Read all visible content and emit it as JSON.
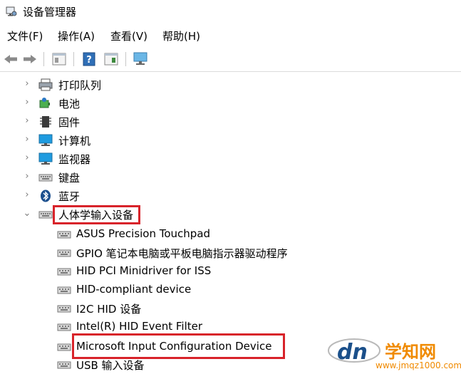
{
  "window": {
    "title": "设备管理器"
  },
  "menubar": [
    {
      "label": "文件(F)"
    },
    {
      "label": "操作(A)"
    },
    {
      "label": "查看(V)"
    },
    {
      "label": "帮助(H)"
    }
  ],
  "toolbar": {
    "buttons": [
      "back-arrow-icon",
      "forward-arrow-icon",
      "properties-icon",
      "help-icon",
      "show-hidden-icon",
      "monitor-icon"
    ]
  },
  "tree": {
    "categories": [
      {
        "label": "打印队列",
        "icon": "printer-icon",
        "expanded": false
      },
      {
        "label": "电池",
        "icon": "battery-icon",
        "expanded": false
      },
      {
        "label": "固件",
        "icon": "chip-icon",
        "expanded": false
      },
      {
        "label": "计算机",
        "icon": "computer-icon",
        "expanded": false
      },
      {
        "label": "监视器",
        "icon": "monitor-icon",
        "expanded": false
      },
      {
        "label": "键盘",
        "icon": "keyboard-icon",
        "expanded": false
      },
      {
        "label": "蓝牙",
        "icon": "bluetooth-icon",
        "expanded": false
      },
      {
        "label": "人体学输入设备",
        "icon": "hid-icon",
        "expanded": true,
        "highlighted": true
      }
    ],
    "children": [
      {
        "label": "ASUS Precision Touchpad"
      },
      {
        "label": "GPIO 笔记本电脑或平板电脑指示器驱动程序"
      },
      {
        "label": "HID PCI Minidriver for ISS"
      },
      {
        "label": "HID-compliant device"
      },
      {
        "label": "I2C HID 设备"
      },
      {
        "label": "Intel(R) HID Event Filter"
      },
      {
        "label": "Microsoft Input Configuration Device",
        "highlighted": true
      },
      {
        "label": "USB 输入设备"
      }
    ]
  },
  "watermark": {
    "text": "学知网",
    "url": "www.jmqz1000.com",
    "brand": "dn"
  },
  "colors": {
    "highlight": "#d8232a",
    "watermark_orange": "#f08a00"
  }
}
